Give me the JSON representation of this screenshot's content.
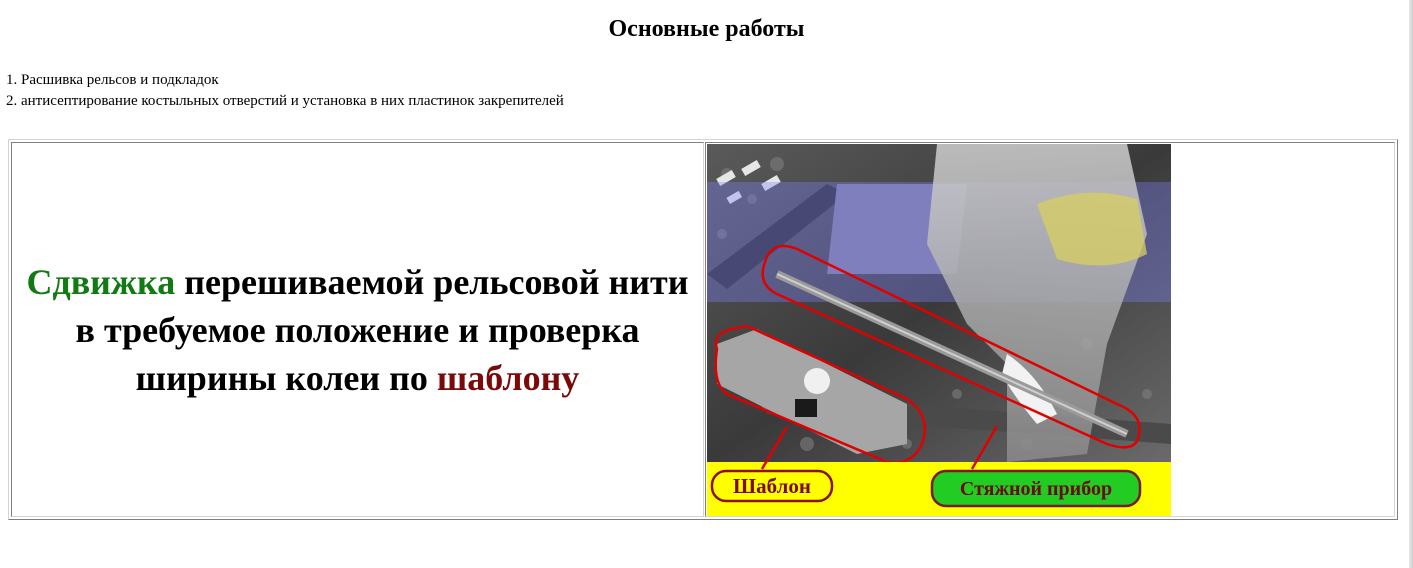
{
  "page": {
    "title": "Основные работы"
  },
  "work_list": [
    "1. Расшивка рельсов и подкладок",
    "2. антисептирование костыльных отверстий и установка в них пластинок закрепителей"
  ],
  "main_text": {
    "highlight_start": "Сдвижка",
    "middle": " перешиваемой рельсовой нити в требуемое положение и проверка ширины колеи по ",
    "highlight_end": "шаблону"
  },
  "photo": {
    "label_left": "Шаблон",
    "label_right": "Стяжной прибор"
  },
  "colors": {
    "highlight_start": "#127a12",
    "highlight_end": "#7a0a0a",
    "callout_outline": "#e00000",
    "label_strip": "#ffff00",
    "label_left_fill": "#ffff00",
    "label_right_fill": "#22cc22"
  }
}
